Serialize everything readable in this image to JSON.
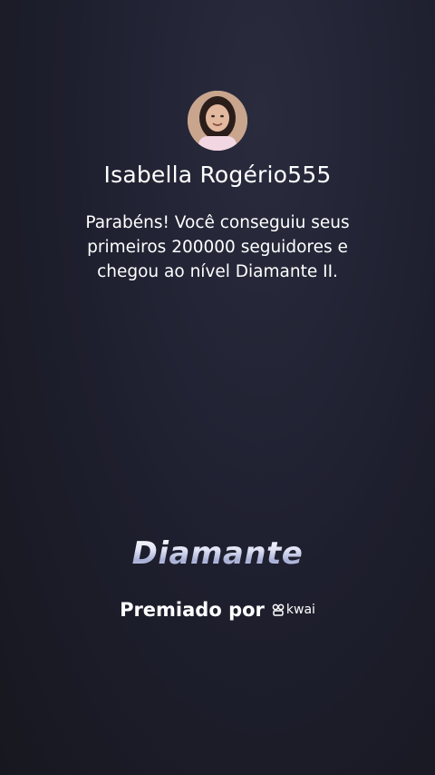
{
  "profile": {
    "username": "Isabella Rogério555",
    "avatar_icon": "user-photo"
  },
  "message": {
    "text": "Parabéns! Você conseguiu seus primeiros 200000 seguidores e chegou ao nível Diamante II."
  },
  "badge": {
    "title": "Diamante"
  },
  "award": {
    "label": "Premiado por",
    "brand": "kwai",
    "brand_icon": "kwai-logo-icon"
  },
  "colors": {
    "background": "#1f2030",
    "text": "#ffffff",
    "badge_gradient_end": "#a7aed4"
  }
}
